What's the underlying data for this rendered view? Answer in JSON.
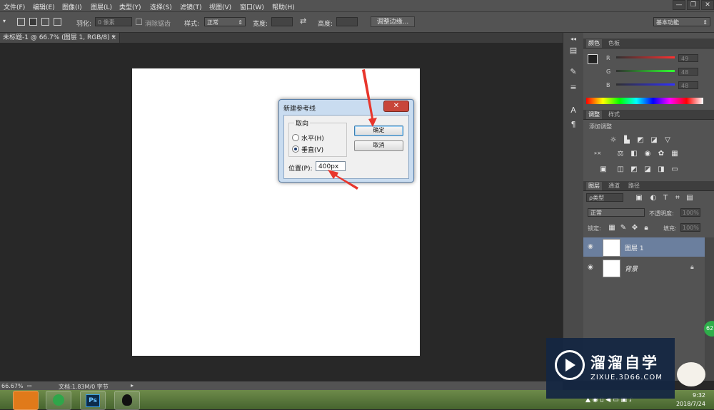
{
  "menu": [
    "文件(F)",
    "编辑(E)",
    "图像(I)",
    "图层(L)",
    "类型(Y)",
    "选择(S)",
    "滤镜(T)",
    "视图(V)",
    "窗口(W)",
    "帮助(H)"
  ],
  "window_controls": [
    "—",
    "❐",
    "✕"
  ],
  "options": {
    "feather_label": "羽化:",
    "feather_value": "0 像素",
    "antialias_label": "消除锯齿",
    "style_label": "样式:",
    "style_value": "正常",
    "width_label": "宽度:",
    "height_label": "高度:",
    "refine_edge": "调整边缘...",
    "workspace": "基本功能"
  },
  "document_tab": "未标题-1 @ 66.7% (图层 1, RGB/8) *",
  "document_tab_close": "×",
  "dialog": {
    "title": "新建参考线",
    "close": "✕",
    "orientation_label": "取向",
    "horizontal": "水平(H)",
    "vertical": "垂直(V)",
    "selected": "vertical",
    "ok": "确定",
    "cancel": "取消",
    "position_label": "位置(P):",
    "position_value": "400px"
  },
  "color_panel": {
    "tabs": [
      "颜色",
      "色板"
    ],
    "channels": [
      {
        "label": "R",
        "value": "49"
      },
      {
        "label": "G",
        "value": "48"
      },
      {
        "label": "B",
        "value": "48"
      }
    ]
  },
  "adjust_panel": {
    "tabs": [
      "调整",
      "样式"
    ],
    "title": "添加调整"
  },
  "layers_panel": {
    "tabs": [
      "图层",
      "通道",
      "路径"
    ],
    "filter": "ρ类型",
    "blend_mode": "正常",
    "opacity_label": "不透明度:",
    "opacity_value": "100%",
    "lock_label": "锁定:",
    "fill_label": "填充:",
    "fill_value": "100%",
    "layers": [
      {
        "name": "图层 1",
        "selected": true
      },
      {
        "name": "背景",
        "selected": false,
        "locked": true
      }
    ]
  },
  "status": {
    "zoom": "66.67%",
    "doc_info": "文档:1.83M/0 字节"
  },
  "taskbar": {
    "ps_label": "Ps",
    "time": "9:32",
    "date": "2018/7/24"
  },
  "watermark": {
    "title": "溜溜自学",
    "sub": "ZIXUE.3D66.COM"
  },
  "green_badge": "62"
}
